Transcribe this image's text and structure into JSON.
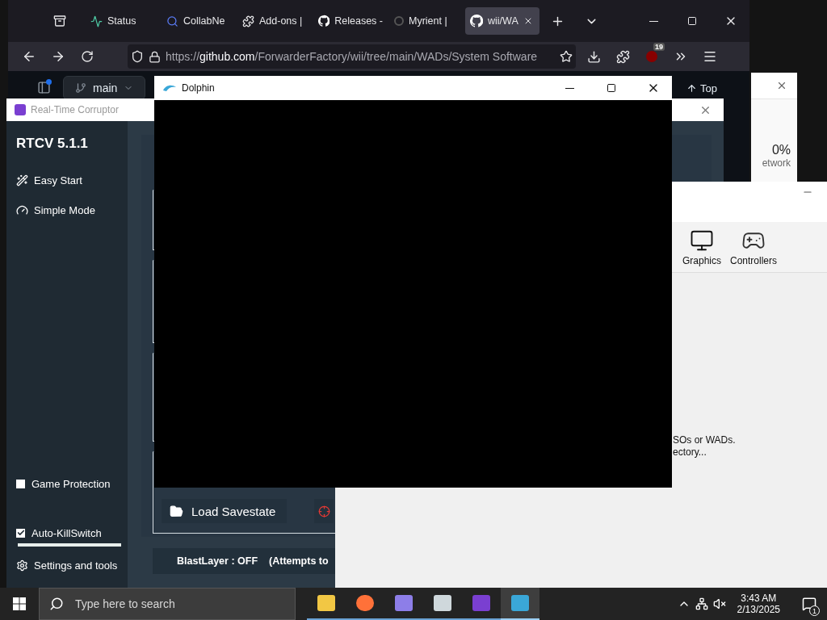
{
  "browser": {
    "tabs": [
      {
        "label": "Status",
        "selected": false
      },
      {
        "label": "CollabNe",
        "selected": false
      },
      {
        "label": "Add-ons |",
        "selected": false
      },
      {
        "label": "Releases -",
        "selected": false
      },
      {
        "label": "Myrient |",
        "selected": false
      },
      {
        "label": "wii/WA",
        "selected": true
      }
    ],
    "url": "https://**github.com**/ForwarderFactory/wii/tree/main/WADs/System Software",
    "extension_badge": "19",
    "branch": "main",
    "top_button": "Top"
  },
  "task_manager": {
    "value": "0%",
    "label": "etwork"
  },
  "rtcv": {
    "title": "Real-Time Corruptor",
    "version": "RTCV 5.1.1",
    "nav": [
      {
        "label": "Easy Start"
      },
      {
        "label": "Simple Mode"
      }
    ],
    "options": [
      {
        "label": "Game Protection",
        "checked": false
      },
      {
        "label": "Auto-KillSwitch",
        "checked": true
      }
    ],
    "killswitch_meter": {
      "level": 1
    },
    "settings": "Settings and tools",
    "load_button": "Load Savestate",
    "blast_status": "BlastLayer : OFF",
    "blast_note": "(Attempts to"
  },
  "dolphin_main": {
    "toolbar": [
      {
        "label": "Graphics"
      },
      {
        "label": "Controllers"
      }
    ],
    "message_lines": [
      "SOs or WADs.",
      "ectory..."
    ]
  },
  "dolphin_render": {
    "title": "Dolphin"
  },
  "taskbar": {
    "search_placeholder": "Type here to search",
    "apps": [
      {
        "selected": false
      },
      {
        "selected": false
      },
      {
        "selected": false
      },
      {
        "selected": false
      },
      {
        "selected": false
      },
      {
        "selected": true
      }
    ],
    "time": "3:43 AM",
    "date": "2/13/2025",
    "notifications": "1"
  }
}
